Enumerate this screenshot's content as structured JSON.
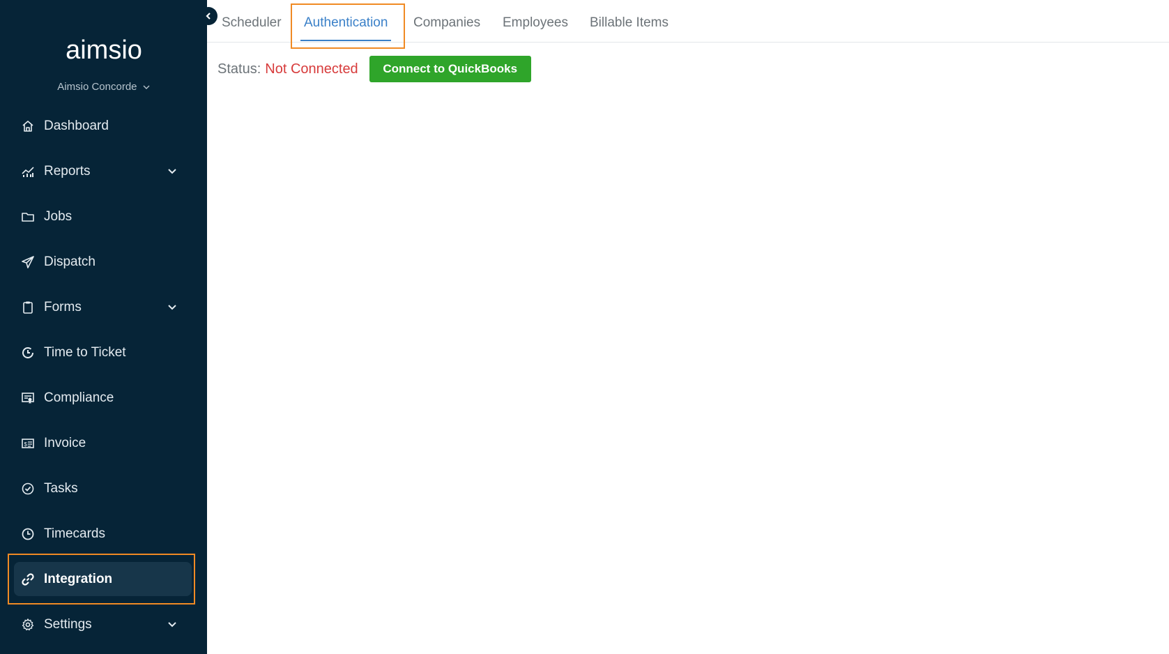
{
  "brand": {
    "logo_text": "aimsio",
    "org_name": "Aimsio Concorde"
  },
  "sidebar": {
    "items": [
      {
        "label": "Dashboard",
        "icon": "home-icon",
        "expandable": false
      },
      {
        "label": "Reports",
        "icon": "chart-icon",
        "expandable": true
      },
      {
        "label": "Jobs",
        "icon": "folder-icon",
        "expandable": false
      },
      {
        "label": "Dispatch",
        "icon": "paper-plane-icon",
        "expandable": false
      },
      {
        "label": "Forms",
        "icon": "clipboard-icon",
        "expandable": true
      },
      {
        "label": "Time to Ticket",
        "icon": "clock-arrow-icon",
        "expandable": false
      },
      {
        "label": "Compliance",
        "icon": "certificate-icon",
        "expandable": false
      },
      {
        "label": "Invoice",
        "icon": "invoice-icon",
        "expandable": false
      },
      {
        "label": "Tasks",
        "icon": "check-circle-icon",
        "expandable": false
      },
      {
        "label": "Timecards",
        "icon": "clock-icon",
        "expandable": false
      },
      {
        "label": "Integration",
        "icon": "link-icon",
        "expandable": false,
        "active": true
      },
      {
        "label": "Settings",
        "icon": "gear-icon",
        "expandable": true
      }
    ]
  },
  "tabs": [
    {
      "label": "Scheduler",
      "active": false
    },
    {
      "label": "Authentication",
      "active": true
    },
    {
      "label": "Companies",
      "active": false
    },
    {
      "label": "Employees",
      "active": false
    },
    {
      "label": "Billable Items",
      "active": false
    }
  ],
  "status": {
    "label": "Status:",
    "value": "Not Connected"
  },
  "connect_button": {
    "label": "Connect to QuickBooks"
  },
  "colors": {
    "sidebar_bg": "#062437",
    "active_pill": "#17364a",
    "highlight": "#f08a24",
    "tab_active": "#3a80c8",
    "status_error": "#d73b3b",
    "button_green": "#2fa52a"
  }
}
